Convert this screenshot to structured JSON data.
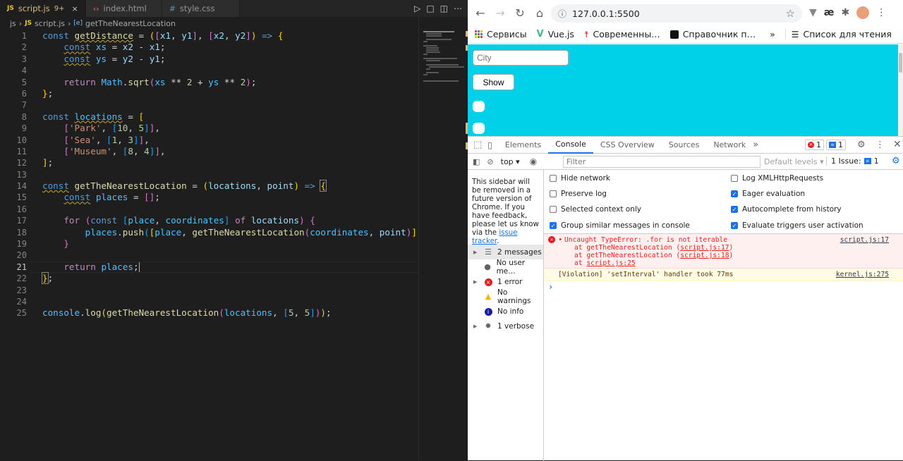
{
  "editor": {
    "tabs": [
      {
        "icon": "JS",
        "label": "script.js",
        "badge": "9+",
        "close": "×"
      },
      {
        "icon": "‹›",
        "label": "index.html"
      },
      {
        "icon": "#",
        "label": "style.css"
      }
    ],
    "breadcrumb": {
      "folder": "js",
      "icon": "JS",
      "file": "script.js",
      "symbol_icon": "[e]",
      "symbol": "getTheNearestLocation"
    },
    "line_numbers": [
      "1",
      "2",
      "3",
      "4",
      "5",
      "6",
      "7",
      "8",
      "9",
      "10",
      "11",
      "12",
      "13",
      "14",
      "15",
      "16",
      "17",
      "18",
      "19",
      "20",
      "21",
      "22",
      "23",
      "24",
      "25"
    ]
  },
  "browser": {
    "url": "127.0.0.1:5500",
    "bookmarks": [
      "Сервисы",
      "Vue.js",
      "Современны…",
      "Справочник п…"
    ],
    "bookmarks_more": "»",
    "reading_list": "Список для чтения",
    "page": {
      "city_placeholder": "City",
      "show_label": "Show"
    }
  },
  "devtools": {
    "tabs": [
      "Elements",
      "Console",
      "CSS Overview",
      "Sources",
      "Network"
    ],
    "more": "»",
    "error_badge": "1",
    "issue_badge": "1",
    "context": "top",
    "filter_placeholder": "Filter",
    "levels": "Default levels",
    "issues": "1 Issue:",
    "issues_count": "1",
    "sidebar_note": "This sidebar will be removed in a future version of Chrome. If you have feedback, please let us know via the",
    "sidebar_link": "issue tracker",
    "sidebar_items": [
      "2 messages",
      "No user me…",
      "1 error",
      "No warnings",
      "No info",
      "1 verbose"
    ],
    "settings": [
      {
        "label": "Hide network",
        "checked": false
      },
      {
        "label": "Log XMLHttpRequests",
        "checked": false
      },
      {
        "label": "Preserve log",
        "checked": false
      },
      {
        "label": "Eager evaluation",
        "checked": true
      },
      {
        "label": "Selected context only",
        "checked": false
      },
      {
        "label": "Autocomplete from history",
        "checked": true
      },
      {
        "label": "Group similar messages in console",
        "checked": true
      },
      {
        "label": "Evaluate triggers user activation",
        "checked": true
      }
    ],
    "error": {
      "text": "Uncaught TypeError: .for is not iterable",
      "source": "script.js:17",
      "stack": [
        {
          "prefix": "at getTheNearestLocation (",
          "link": "script.js:17",
          "suffix": ")"
        },
        {
          "prefix": "at getTheNearestLocation (",
          "link": "script.js:18",
          "suffix": ")"
        },
        {
          "prefix": "at ",
          "link": "script.js:25",
          "suffix": ""
        }
      ]
    },
    "violation": {
      "text": "[Violation] 'setInterval' handler took 77ms",
      "source": "kernel.js:275"
    },
    "prompt": "›"
  }
}
